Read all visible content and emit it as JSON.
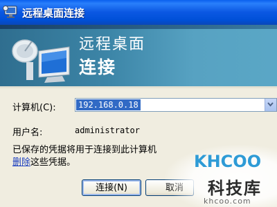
{
  "window": {
    "title": "远程桌面连接"
  },
  "banner": {
    "line1": "远程桌面",
    "line2": "连接"
  },
  "form": {
    "computer_label": "计算机(C):",
    "computer_value": "192.168.0.18",
    "username_label": "用户名:",
    "username_value": "administrator",
    "info_text": "已保存的凭据将用于连接到此计算机",
    "info_link": "删除",
    "info_tail": "这些凭据。"
  },
  "buttons": {
    "connect": "连接(N)",
    "cancel": "取消"
  },
  "watermark": {
    "logo": "KHCOO",
    "brand": "科技库",
    "domain": "khcoo.com"
  },
  "icons": {
    "title": "remote-desktop-icon",
    "banner": "remote-desktop-monitor-icon",
    "dropdown": "chevron-down-icon"
  },
  "colors": {
    "titlebar": "#0b58e3",
    "banner": "#3d86a8",
    "selection": "#316ac5",
    "link": "#1c3fbf"
  }
}
